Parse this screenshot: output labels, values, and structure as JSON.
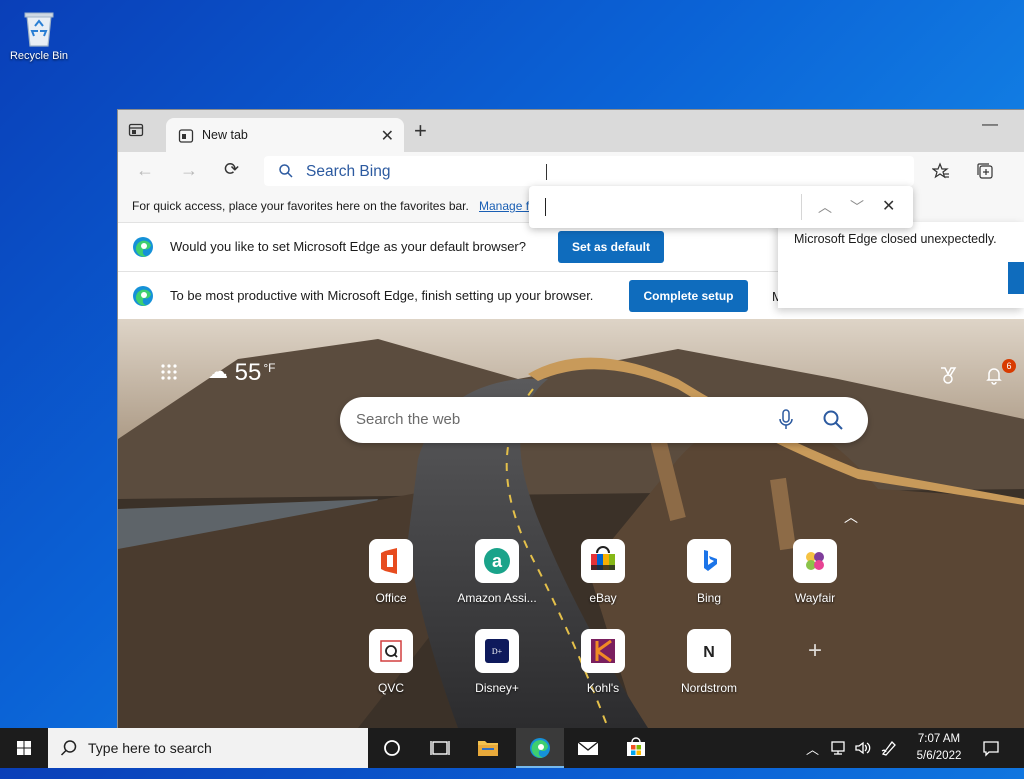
{
  "desktop": {
    "recycle_bin_label": "Recycle Bin"
  },
  "browser": {
    "tab_title": "New tab",
    "address_placeholder": "Search Bing",
    "favorites_hint": "For quick access, place your favorites here on the favorites bar.",
    "favorites_manage_link": "Manage f",
    "default_prompt": "Would you like to set Microsoft Edge as your default browser?",
    "default_button": "Set as default",
    "setup_prompt": "To be most productive with Microsoft Edge, finish setting up your browser.",
    "setup_button": "Complete setup",
    "setup_trailing": "M",
    "crash_message": "Microsoft Edge closed unexpectedly.",
    "accent_color": "#0f6cbd"
  },
  "new_tab_page": {
    "weather_temp": "55",
    "weather_unit": "°F",
    "notification_count": "6",
    "search_placeholder": "Search the web",
    "quick_links": [
      {
        "name": "Office",
        "icon": "office-icon"
      },
      {
        "name": "Amazon Assi...",
        "icon": "amazon-assistant-icon"
      },
      {
        "name": "eBay",
        "icon": "ebay-icon"
      },
      {
        "name": "Bing",
        "icon": "bing-icon"
      },
      {
        "name": "Wayfair",
        "icon": "wayfair-icon"
      },
      {
        "name": "QVC",
        "icon": "qvc-icon"
      },
      {
        "name": "Disney+",
        "icon": "disney-plus-icon"
      },
      {
        "name": "Kohl's",
        "icon": "kohls-icon"
      },
      {
        "name": "Nordstrom",
        "icon": "nordstrom-icon"
      }
    ]
  },
  "taskbar": {
    "search_placeholder": "Type here to search",
    "time": "7:07 AM",
    "date": "5/6/2022"
  }
}
